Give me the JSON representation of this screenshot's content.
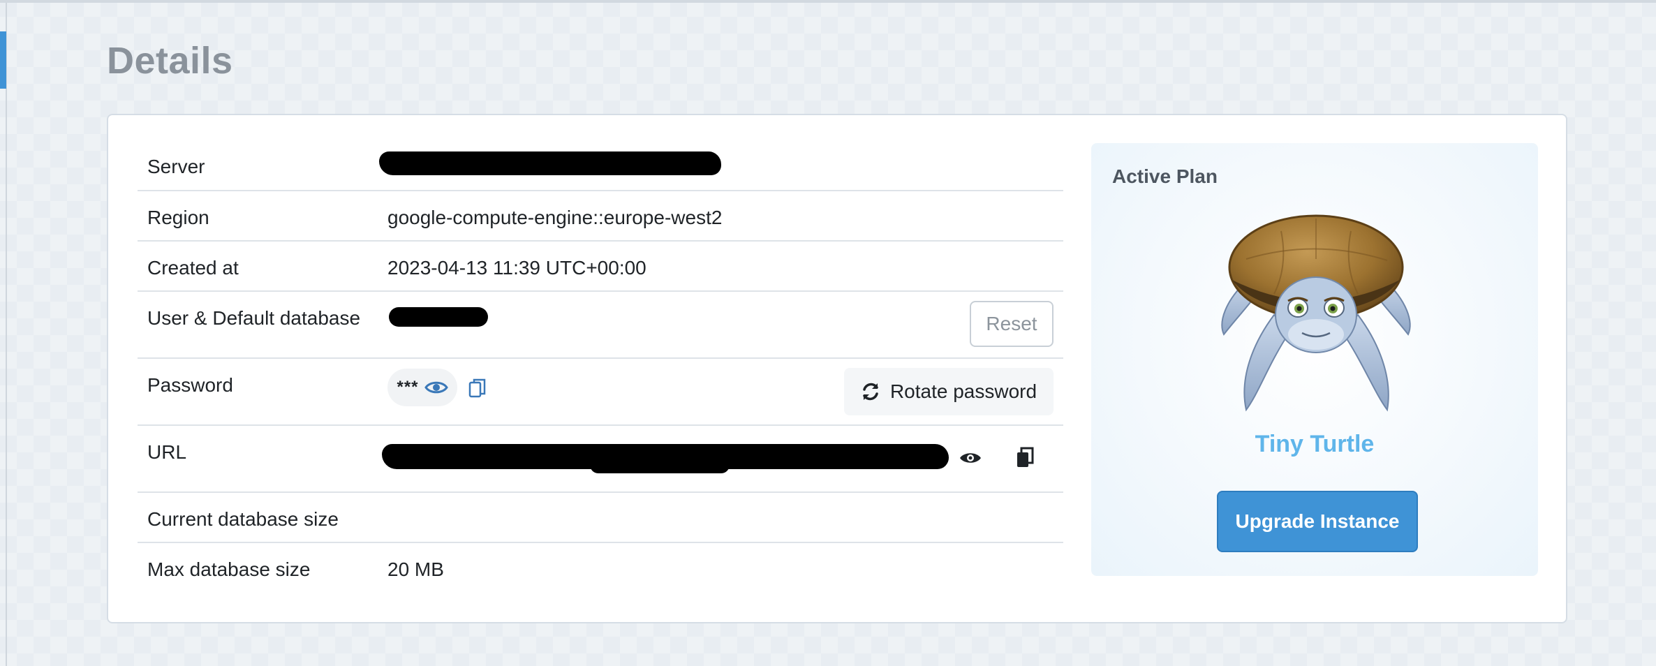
{
  "page": {
    "title": "Details"
  },
  "details": {
    "rows": [
      {
        "label": "Server",
        "value": ""
      },
      {
        "label": "Region",
        "value": "google-compute-engine::europe-west2"
      },
      {
        "label": "Created at",
        "value": "2023-04-13 11:39 UTC+00:00"
      },
      {
        "label": "User & Default database",
        "value": ""
      },
      {
        "label": "Password",
        "value": "***"
      },
      {
        "label": "URL",
        "value": ""
      },
      {
        "label": "Current database size",
        "value": ""
      },
      {
        "label": "Max database size",
        "value": "20 MB"
      }
    ],
    "reset_label": "Reset",
    "rotate_password_label": "Rotate password"
  },
  "plan": {
    "heading": "Active Plan",
    "name": "Tiny Turtle",
    "upgrade_label": "Upgrade Instance"
  },
  "icons": {
    "reveal_password": "eye-icon",
    "copy_password": "copy-icon",
    "reveal_url": "eye-icon",
    "copy_url": "clipboard-icon",
    "rotate": "refresh-icon",
    "mascot": "turtle-icon"
  },
  "colors": {
    "accent": "#3f93d6",
    "plan_name": "#5fb5ea",
    "title": "#8a929b"
  }
}
